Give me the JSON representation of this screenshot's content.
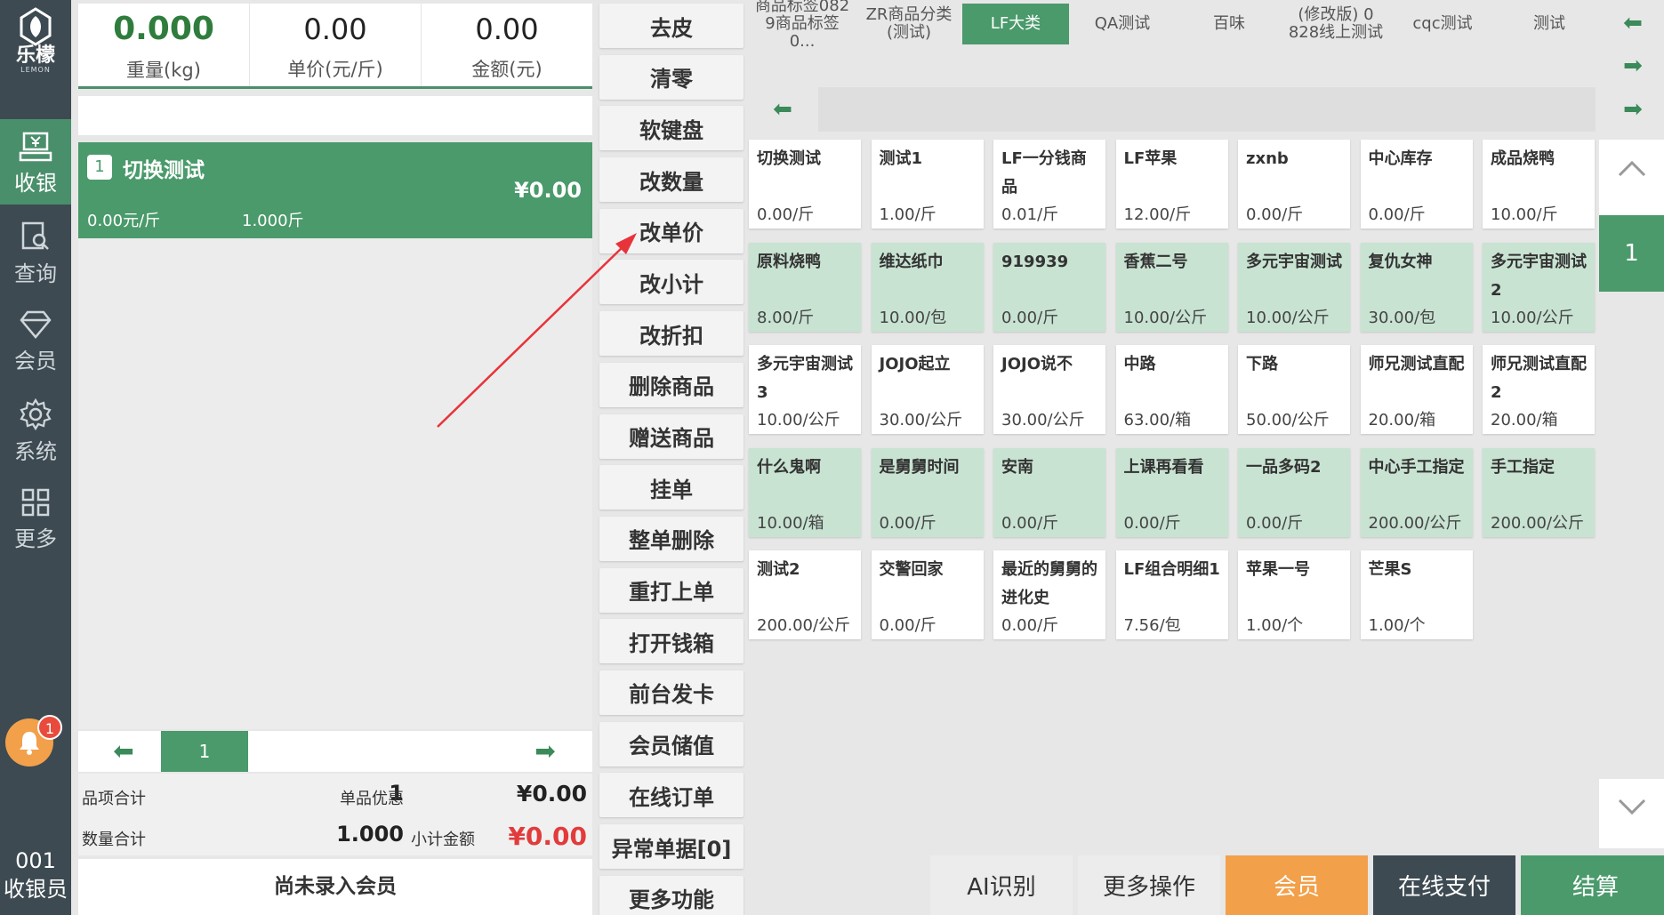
{
  "app": {
    "logo_text": "乐檬",
    "logo_sub": "LEMON"
  },
  "sidebar": {
    "items": [
      {
        "label": "收银",
        "icon": "cash-register-icon",
        "active": true
      },
      {
        "label": "查询",
        "icon": "search-doc-icon"
      },
      {
        "label": "会员",
        "icon": "diamond-icon"
      },
      {
        "label": "系统",
        "icon": "gear-icon"
      },
      {
        "label": "更多",
        "icon": "grid-icon"
      }
    ],
    "notification_count": "1",
    "cashier_id": "001",
    "cashier_label": "收银员"
  },
  "scale": {
    "weight_value": "0.000",
    "weight_label": "重量(kg)",
    "unit_price_value": "0.00",
    "unit_price_label": "单价(元/斤)",
    "amount_value": "0.00",
    "amount_label": "金额(元)"
  },
  "scan": {
    "value": "",
    "placeholder": ""
  },
  "cart": {
    "items": [
      {
        "index": "1",
        "name": "切换测试",
        "price": "¥0.00",
        "unit_price": "0.00元/斤",
        "qty": "1.000斤"
      }
    ],
    "page": "1"
  },
  "summary": {
    "item_total_label": "品项合计",
    "item_total_value": "1",
    "discount_label": "单品优惠",
    "discount_value": "¥0.00",
    "qty_total_label": "数量合计",
    "qty_total_value": "1.000",
    "subtotal_label": "小计金额",
    "subtotal_value": "¥0.00"
  },
  "member_bar": {
    "label": "尚未录入会员"
  },
  "functions": [
    "去皮",
    "清零",
    "软键盘",
    "改数量",
    "改单价",
    "改小计",
    "改折扣",
    "删除商品",
    "赠送商品",
    "挂单",
    "整单删除",
    "重打上单",
    "打开钱箱",
    "前台发卡",
    "会员储值",
    "在线订单",
    "异常单据[0]",
    "更多功能"
  ],
  "categories": [
    {
      "label": "商品标签082\n9商品标签0..."
    },
    {
      "label": "ZR商品分类\n(测试)"
    },
    {
      "label": "LF大类",
      "active": true
    },
    {
      "label": "QA测试"
    },
    {
      "label": "百味"
    },
    {
      "label": "(修改版) 0\n828线上测试"
    },
    {
      "label": "cqc测试"
    },
    {
      "label": "测试"
    }
  ],
  "products": [
    {
      "name": "切换测试",
      "price": "0.00/斤",
      "green": false
    },
    {
      "name": "测试1",
      "price": "1.00/斤",
      "green": false
    },
    {
      "name": "LF一分钱商品",
      "price": "0.01/斤",
      "green": false
    },
    {
      "name": "LF苹果",
      "price": "12.00/斤",
      "green": false
    },
    {
      "name": "zxnb",
      "price": "0.00/斤",
      "green": false
    },
    {
      "name": "中心库存",
      "price": "0.00/斤",
      "green": false
    },
    {
      "name": "成品烧鸭",
      "price": "10.00/斤",
      "green": false
    },
    {
      "name": "原料烧鸭",
      "price": "8.00/斤",
      "green": true
    },
    {
      "name": "维达纸巾",
      "price": "10.00/包",
      "green": true
    },
    {
      "name": "919939",
      "price": "0.00/斤",
      "green": true
    },
    {
      "name": "香蕉二号",
      "price": "10.00/公斤",
      "green": true
    },
    {
      "name": "多元宇宙测试",
      "price": "10.00/公斤",
      "green": true
    },
    {
      "name": "复仇女神",
      "price": "30.00/包",
      "green": true
    },
    {
      "name": "多元宇宙测试2",
      "price": "10.00/公斤",
      "green": true
    },
    {
      "name": "多元宇宙测试3",
      "price": "10.00/公斤",
      "green": false
    },
    {
      "name": "JOJO起立",
      "price": "30.00/公斤",
      "green": false
    },
    {
      "name": "JOJO说不",
      "price": "30.00/公斤",
      "green": false
    },
    {
      "name": "中路",
      "price": "63.00/箱",
      "green": false
    },
    {
      "name": "下路",
      "price": "50.00/公斤",
      "green": false
    },
    {
      "name": "师兄测试直配",
      "price": "20.00/箱",
      "green": false
    },
    {
      "name": "师兄测试直配2",
      "price": "20.00/箱",
      "green": false
    },
    {
      "name": "什么鬼啊",
      "price": "10.00/箱",
      "green": true
    },
    {
      "name": "是舅舅时间",
      "price": "0.00/斤",
      "green": true
    },
    {
      "name": "安南",
      "price": "0.00/斤",
      "green": true
    },
    {
      "name": "上课再看看",
      "price": "0.00/斤",
      "green": true
    },
    {
      "name": "一品多码2",
      "price": "0.00/斤",
      "green": true
    },
    {
      "name": "中心手工指定",
      "price": "200.00/公斤",
      "green": true
    },
    {
      "name": "手工指定",
      "price": "200.00/公斤",
      "green": true
    },
    {
      "name": "测试2",
      "price": "200.00/公斤",
      "green": false
    },
    {
      "name": "交警回家",
      "price": "0.00/斤",
      "green": false
    },
    {
      "name": "最近的舅舅的进化史",
      "price": "0.00/斤",
      "green": false
    },
    {
      "name": "LF组合明细1",
      "price": "7.56/包",
      "green": false
    },
    {
      "name": "苹果一号",
      "price": "1.00/个",
      "green": false
    },
    {
      "name": "芒果S",
      "price": "1.00/个",
      "green": false
    }
  ],
  "product_page": "1",
  "actions": [
    {
      "label": "AI识别",
      "style": "plain"
    },
    {
      "label": "更多操作",
      "style": "plain"
    },
    {
      "label": "会员",
      "style": "orange"
    },
    {
      "label": "在线支付",
      "style": "dark"
    },
    {
      "label": "结算",
      "style": "green"
    }
  ],
  "colors": {
    "accent": "#4a9a6b",
    "sidebar": "#3d4a52",
    "orange": "#f2a04a",
    "red": "#e23b3b",
    "arrow": "#e8333a"
  }
}
